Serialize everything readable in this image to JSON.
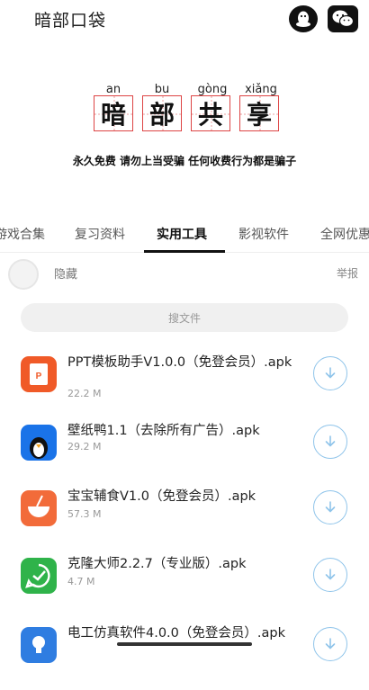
{
  "header": {
    "title": "暗部口袋",
    "qq_icon": "qq-penguin-icon",
    "wechat_icon": "wechat-icon"
  },
  "banner": {
    "characters": [
      {
        "pinyin": "an",
        "char": "暗"
      },
      {
        "pinyin": "bu",
        "char": "部"
      },
      {
        "pinyin": "gòng",
        "char": "共"
      },
      {
        "pinyin": "xiǎng",
        "char": "享"
      }
    ],
    "slogan": "永久免费 请勿上当受骗 任何收费行为都是骗子",
    "accent_color": "#dd4444"
  },
  "tabs": [
    {
      "label": "游戏合集",
      "active": false
    },
    {
      "label": "复习资料",
      "active": false
    },
    {
      "label": "实用工具",
      "active": true
    },
    {
      "label": "影视软件",
      "active": false
    },
    {
      "label": "全网优惠",
      "active": false
    }
  ],
  "hidden_row": {
    "label": "隐藏",
    "report": "举报"
  },
  "search": {
    "placeholder": "搜文件"
  },
  "files": [
    {
      "name": "PPT模板助手V1.0.0（免登会员）.apk",
      "size": "22.2 M",
      "icon": "ppt-icon",
      "color": "#f05a28"
    },
    {
      "name": "壁纸鸭1.1（去除所有广告）.apk",
      "size": "29.2 M",
      "icon": "penguin-wallpaper-icon",
      "color": "#1a73e8"
    },
    {
      "name": "宝宝辅食V1.0（免登会员）.apk",
      "size": "57.3 M",
      "icon": "bowl-icon",
      "color": "#f26b3a"
    },
    {
      "name": "克隆大师2.2.7（专业版）.apk",
      "size": "4.7 M",
      "icon": "clone-icon",
      "color": "#2fb34a"
    },
    {
      "name": "电工仿真软件4.0.0（免登会员）.apk",
      "size": "",
      "icon": "bulb-icon",
      "color": "#2f7de1"
    }
  ]
}
